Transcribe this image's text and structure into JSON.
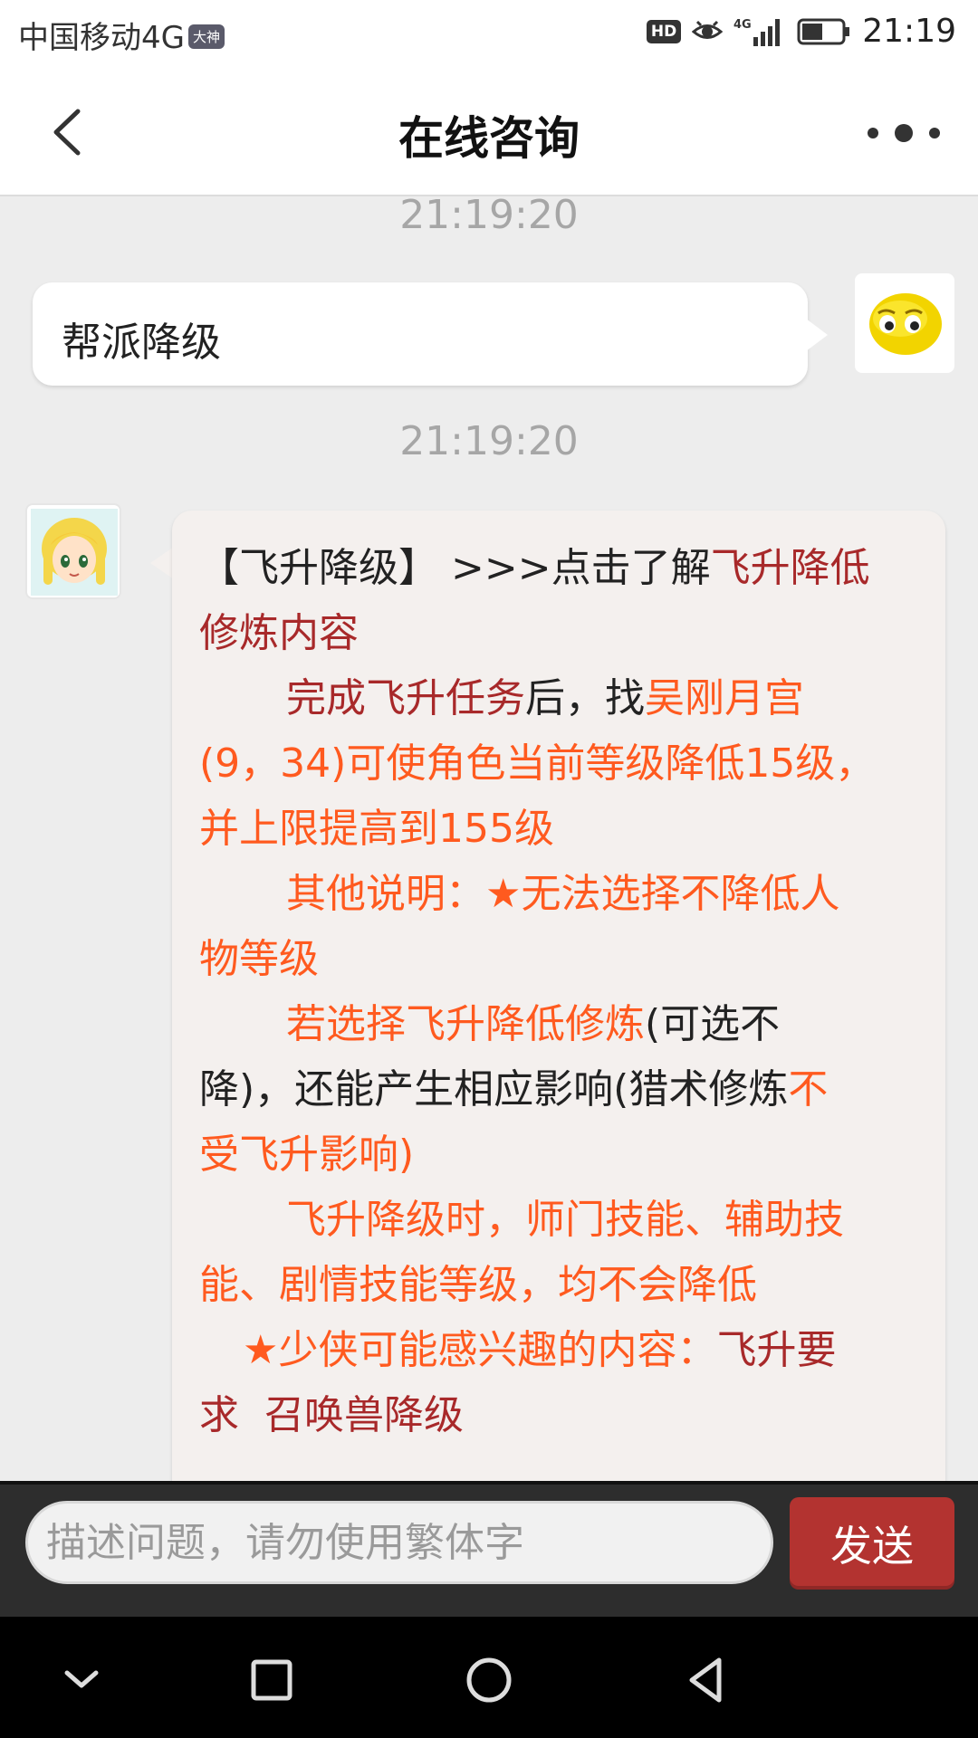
{
  "status_bar": {
    "carrier": "中国移动4G",
    "carrier_badge": "大神",
    "hd_label": "HD",
    "network_label": "4G",
    "time": "21:19"
  },
  "header": {
    "title": "在线咨询"
  },
  "chat": {
    "timestamp_1": "21:19:20",
    "user_message": "帮派降级",
    "timestamp_2": "21:19:20",
    "bot_message": {
      "line1_a": "【飞升降级】 >>>点击了解",
      "line1_b": "飞升降低",
      "line2": "修炼内容",
      "line3_a": "完成飞升任务",
      "line3_b": "后，找",
      "line3_c": "吴刚月宫",
      "line4": "(9，34)可使角色当前等级降低15级，",
      "line5": "并上限提高到155级",
      "line6": "其他说明：★无法选择不降低人",
      "line7": "物等级",
      "line8_a": "若选择飞升降低修炼",
      "line8_b": "(可选不",
      "line9_a": "降)，还能产生相应影响(猎术修炼",
      "line9_b": "不",
      "line10": "受飞升影响)",
      "line11": "飞升降级时，师门技能、辅助技",
      "line12": "能、剧情技能等级，均不会降低",
      "line13": "★少侠可能感兴趣的内容：",
      "line13_link": "飞升要",
      "line14_a": "求",
      "line14_b": "召唤兽降级"
    }
  },
  "input": {
    "placeholder": "描述问题，请勿使用繁体字",
    "send_label": "发送"
  },
  "colors": {
    "maroon": "#a8292a",
    "orange": "#ff5a1f",
    "send_button": "#b33330"
  }
}
